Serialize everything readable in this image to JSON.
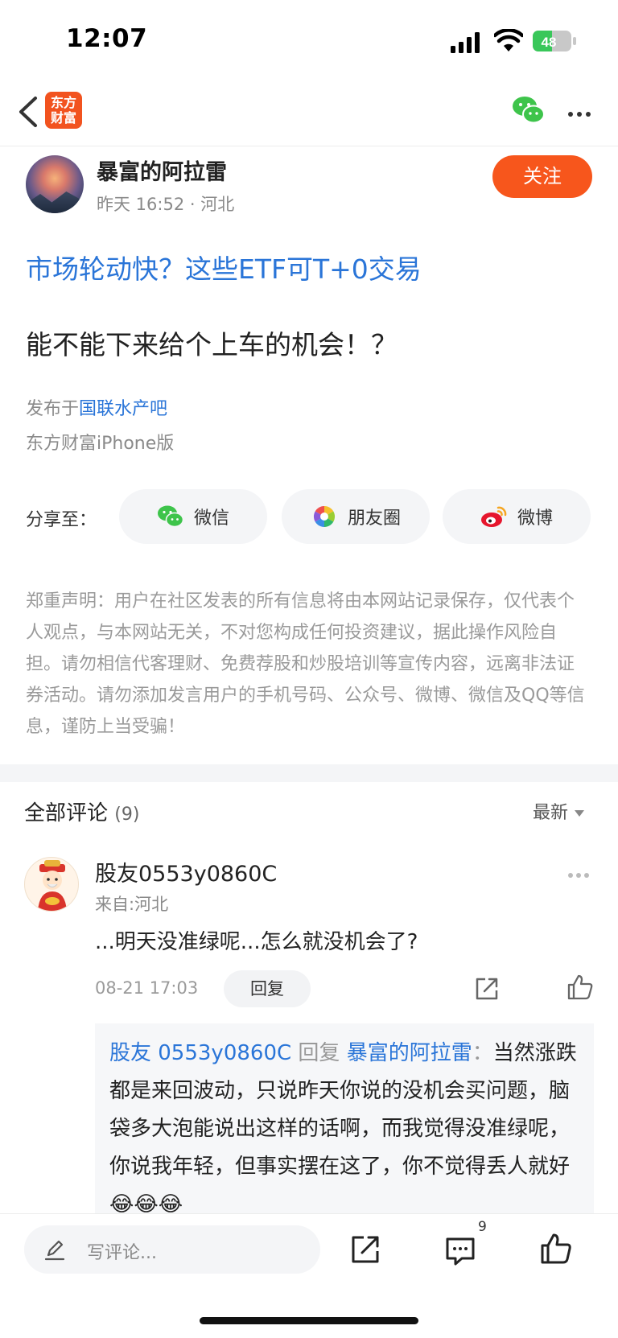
{
  "status_bar": {
    "time": "12:07",
    "battery": "48"
  },
  "nav": {
    "logo_line1": "东方",
    "logo_line2": "财富"
  },
  "author": {
    "name": "暴富的阿拉雷",
    "meta": "昨天 16:52 · 河北",
    "follow_label": "关注"
  },
  "post": {
    "topic_title": "市场轮动快？这些ETF可T+0交易",
    "body": "能不能下来给个上车的机会！？",
    "published_prefix": "发布于",
    "published_bar": "国联水产吧",
    "device": "东方财富iPhone版"
  },
  "share": {
    "label": "分享至：",
    "items": [
      {
        "label": "微信",
        "icon": "wechat-icon"
      },
      {
        "label": "朋友圈",
        "icon": "moments-icon"
      },
      {
        "label": "微博",
        "icon": "weibo-icon"
      }
    ]
  },
  "disclaimer": "郑重声明：用户在社区发表的所有信息将由本网站记录保存，仅代表个人观点，与本网站无关，不对您构成任何投资建议，据此操作风险自担。请勿相信代客理财、免费荐股和炒股培训等宣传内容，远离非法证券活动。请勿添加发言用户的手机号码、公众号、微博、微信及QQ等信息，谨防上当受骗！",
  "comments": {
    "title": "全部评论",
    "count": "(9)",
    "sort_label": "最新",
    "items": [
      {
        "name": "股友0553y0860C",
        "from": "来自:河北",
        "text": "...明天没准绿呢...怎么就没机会了?",
        "time": "08-21 17:03",
        "reply_label": "回复",
        "reply": {
          "from_user": "股友 0553y0860C",
          "verb": "回复",
          "to_user": "暴富的阿拉雷",
          "separator": "：",
          "text": "当然涨跌都是来回波动，只说昨天你说的没机会买问题，脑袋多大泡能说出这样的话啊，而我觉得没准绿呢，你说我年轻，但事实摆在这了，你不觉得丢人就好😂😂😂"
        }
      }
    ]
  },
  "bottom_bar": {
    "placeholder": "写评论...",
    "comment_count": "9"
  },
  "colors": {
    "accent": "#f7561c",
    "link": "#2a75d8"
  }
}
